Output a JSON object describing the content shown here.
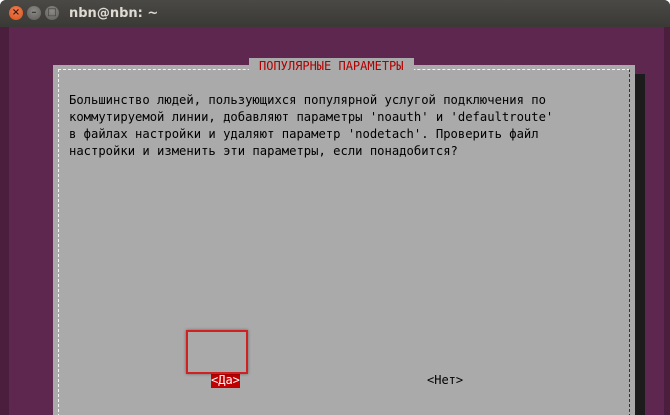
{
  "window": {
    "title": "nbn@nbn: ~",
    "buttons": {
      "close_icon": "close-icon",
      "minimize_icon": "minimize-icon",
      "maximize_icon": "maximize-icon"
    }
  },
  "dialog": {
    "title": "ПОПУЛЯРНЫЕ ПАРАМЕТРЫ",
    "message_lines": [
      "Большинство людей, пользующихся популярной услугой подключения по",
      "коммутируемой линии, добавляют параметры 'noauth' и 'defaultroute'",
      "в файлах настройки и удаляют параметр 'nodetach'. Проверить файл",
      "настройки и изменить эти параметры, если понадобится?"
    ],
    "yes_label": "<Да>",
    "no_label": "<Нет>"
  },
  "colors": {
    "terminal_bg": "#5e2750",
    "dialog_bg": "#aaaaaa",
    "title_text": "#b00000",
    "selected_button_bg": "#c00000",
    "highlight_border": "#d02020"
  }
}
